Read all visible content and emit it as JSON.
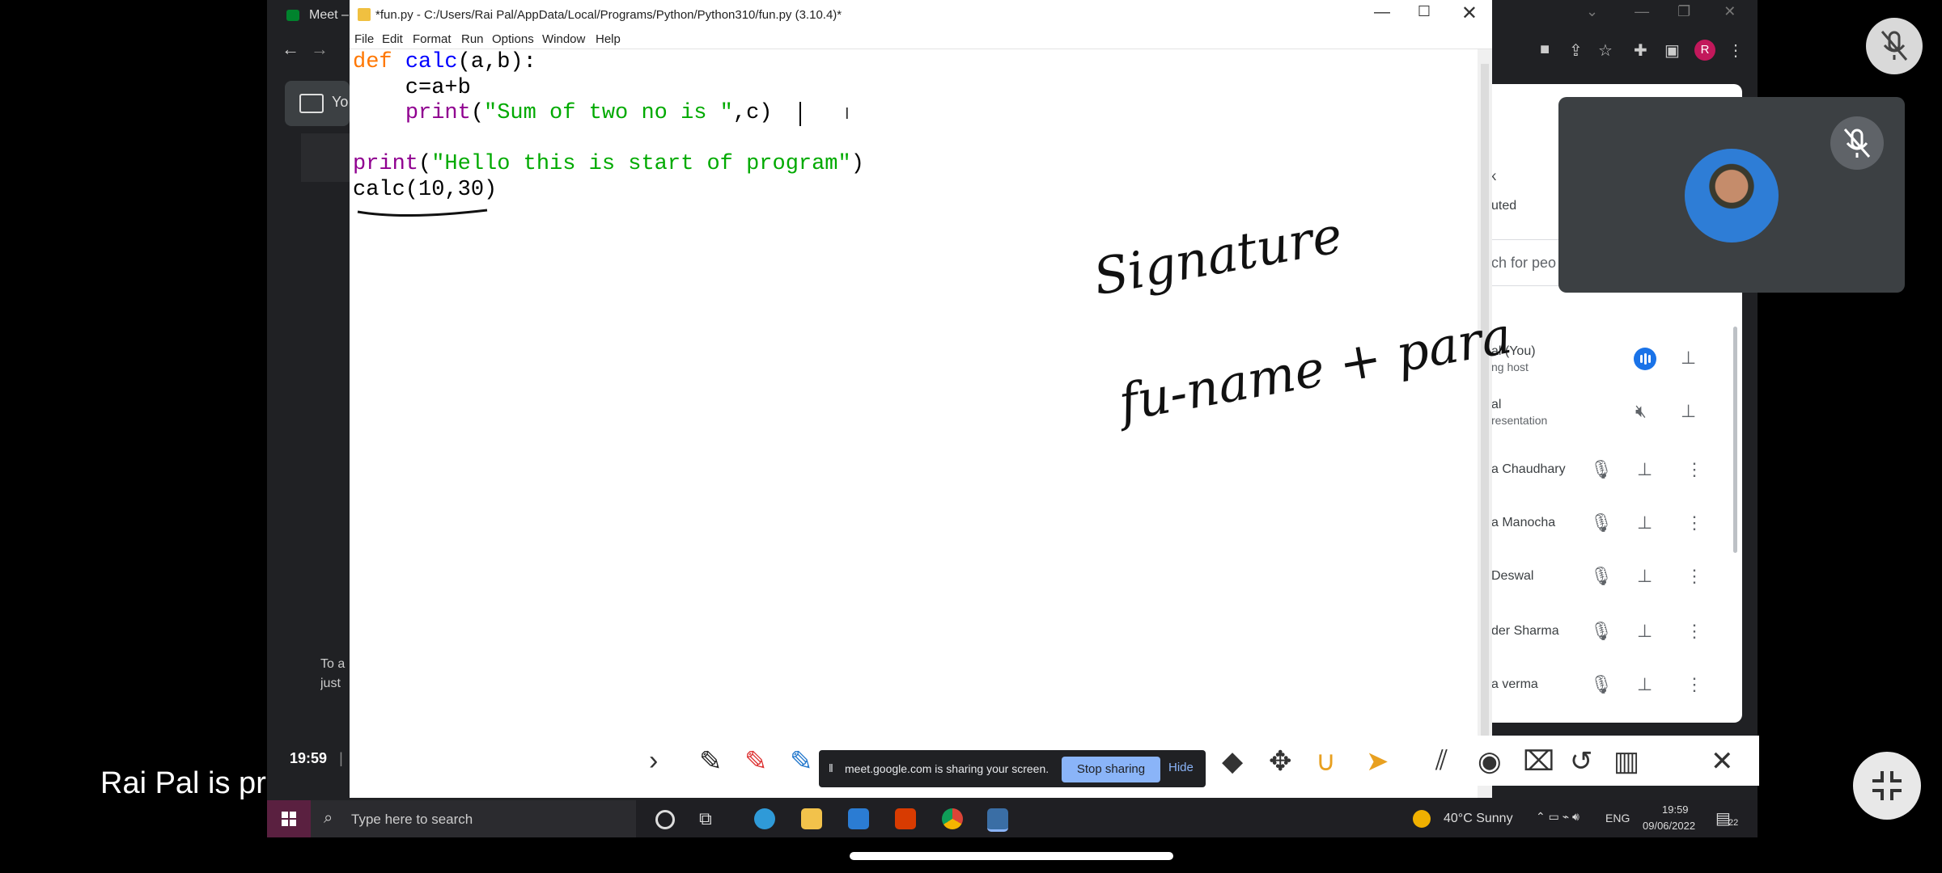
{
  "presenter_label": "Rai Pal is presenting",
  "browser": {
    "tab_title": "Meet –",
    "side_label": "Yo",
    "join_text_line1": "To a",
    "join_text_line2": "just",
    "clock": "19:59",
    "clock_sep": "|",
    "profile_initial": "R"
  },
  "idle": {
    "title": "*fun.py - C:/Users/Rai Pal/AppData/Local/Programs/Python/Python310/fun.py (3.10.4)*",
    "menu": [
      "File",
      "Edit",
      "Format",
      "Run",
      "Options",
      "Window",
      "Help"
    ],
    "code": {
      "l1_kw": "def",
      "l1_fn": "calc",
      "l1_rest": "(a,b):",
      "l2": "    c=a+b",
      "l3_bi": "print",
      "l3_open": "(",
      "l3_str": "\"Sum of two no is \"",
      "l3_rest": ",c)",
      "l5_bi": "print",
      "l5_open": "(",
      "l5_str": "\"Hello this is start of program\"",
      "l5_close": ")",
      "l6": "calc(10,30)"
    }
  },
  "handwriting": {
    "line1": "Signature",
    "line2": "fu-name + para"
  },
  "share_bar": {
    "message": "meet.google.com is sharing your screen.",
    "stop_label": "Stop sharing",
    "hide_label": "Hide"
  },
  "people_panel": {
    "partial_header": "k",
    "partial_muted": "uted",
    "search_placeholder": "ch for peo",
    "participants": [
      {
        "name": "al (You)",
        "sub": "ng host"
      },
      {
        "name": "al",
        "sub": "resentation"
      },
      {
        "name": "a Chaudhary",
        "sub": ""
      },
      {
        "name": "a Manocha",
        "sub": ""
      },
      {
        "name": "Deswal",
        "sub": ""
      },
      {
        "name": "der Sharma",
        "sub": ""
      },
      {
        "name": "a verma",
        "sub": ""
      }
    ]
  },
  "taskbar": {
    "search_placeholder": "Type here to search",
    "weather": "40°C  Sunny",
    "lang": "ENG",
    "time": "19:59",
    "date": "09/06/2022",
    "notif_count": "22"
  },
  "icons": {
    "mute": "mic-off-icon",
    "pin": "pin-icon",
    "more": "more-vert-icon"
  }
}
